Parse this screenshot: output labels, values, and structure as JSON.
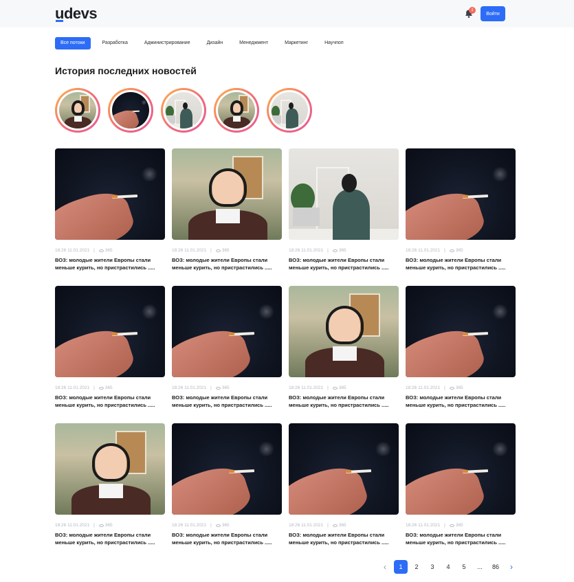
{
  "header": {
    "logo_u": "u",
    "logo_rest": "devs",
    "notification_count": "1",
    "login_label": "Войти",
    "accent_color": "#2d6cf6"
  },
  "tabs": [
    "Все потоки",
    "Разработка",
    "Администрирование",
    "Дизайн",
    "Менеджмент",
    "Маркетинг",
    "Научпоп"
  ],
  "active_tab": "Все потоки",
  "stories_title": "История последних новостей",
  "stories": [
    "girl",
    "smoke",
    "woman",
    "girl",
    "woman"
  ],
  "articles": [
    {
      "image": "smoke",
      "time": "18:26 11.01.2021",
      "views": "365",
      "title": "ВОЗ: молодые жители Европы стали меньше курить, но пристрастились ....."
    },
    {
      "image": "girl",
      "time": "18:26 11.01.2021",
      "views": "365",
      "title": "ВОЗ: молодые жители Европы стали меньше курить, но пристрастились ....."
    },
    {
      "image": "woman",
      "time": "18:26 11.01.2021",
      "views": "365",
      "title": "ВОЗ: молодые жители Европы стали меньше курить, но пристрастились ....."
    },
    {
      "image": "smoke",
      "time": "18:26 11.01.2021",
      "views": "365",
      "title": "ВОЗ: молодые жители Европы стали меньше курить, но пристрастились ....."
    },
    {
      "image": "smoke",
      "time": "18:26 11.01.2021",
      "views": "365",
      "title": "ВОЗ: молодые жители Европы стали меньше курить, но пристрастились ....."
    },
    {
      "image": "smoke",
      "time": "18:26 11.01.2021",
      "views": "365",
      "title": "ВОЗ: молодые жители Европы стали меньше курить, но пристрастились ....."
    },
    {
      "image": "girl",
      "time": "18:26 11.01.2021",
      "views": "365",
      "title": "ВОЗ: молодые жители Европы стали меньше курить, но пристрастились ....."
    },
    {
      "image": "smoke",
      "time": "18:26 11.01.2021",
      "views": "365",
      "title": "ВОЗ: молодые жители Европы стали меньше курить, но пристрастились ....."
    },
    {
      "image": "girl",
      "time": "18:26 11.01.2021",
      "views": "365",
      "title": "ВОЗ: молодые жители Европы стали меньше курить, но пристрастились ....."
    },
    {
      "image": "smoke",
      "time": "18:26 11.01.2021",
      "views": "365",
      "title": "ВОЗ: молодые жители Европы стали меньше курить, но пристрастились ....."
    },
    {
      "image": "smoke",
      "time": "18:26 11.01.2021",
      "views": "365",
      "title": "ВОЗ: молодые жители Европы стали меньше курить, но пристрастились ....."
    },
    {
      "image": "smoke",
      "time": "18:26 11.01.2021",
      "views": "365",
      "title": "ВОЗ: молодые жители Европы стали меньше курить, но пристрастились ....."
    }
  ],
  "pagination": {
    "prev_icon": "chevron-left-icon",
    "pages": [
      "1",
      "2",
      "3",
      "4",
      "5",
      "...",
      "86"
    ],
    "current": "1",
    "next_icon": "chevron-right-icon"
  }
}
